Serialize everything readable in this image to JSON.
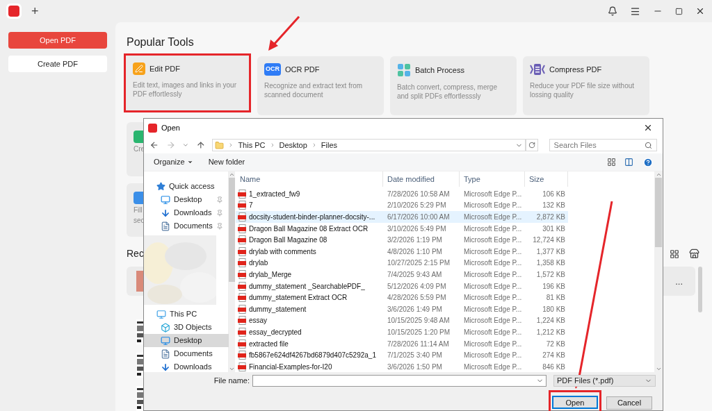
{
  "app": {
    "new_tab": "+"
  },
  "sidebar": {
    "buttons": [
      {
        "label": "Open PDF",
        "kind": "primary"
      },
      {
        "label": "Create PDF",
        "kind": "secondary"
      }
    ]
  },
  "popular_tools": {
    "title": "Popular Tools",
    "cards": [
      {
        "kind": "edit",
        "title": "Edit PDF",
        "description": "Edit text, images and links in your PDF effortlessly",
        "highlighted": true
      },
      {
        "kind": "ocr",
        "icon_text": "OCR",
        "title": "OCR PDF",
        "description": "Recognize and extract text from scanned document",
        "highlighted": false
      },
      {
        "kind": "batch",
        "title": "Batch Process",
        "description": "Batch convert, compress, merge and split PDFs effortlesssly",
        "highlighted": false
      },
      {
        "kind": "compress",
        "title": "Compress PDF",
        "description": "Reduce your PDF file size without lossing quality",
        "highlighted": false
      }
    ]
  },
  "more_tools": [
    {
      "kind": "create",
      "lines": [
        "Cre"
      ]
    },
    {
      "kind": "form",
      "lines": [
        "Fill",
        "sec"
      ]
    }
  ],
  "recent": {
    "title": "Rec",
    "more": "..."
  },
  "dialog": {
    "title": "Open",
    "breadcrumb": [
      "This PC",
      "Desktop",
      "Files"
    ],
    "search": {
      "placeholder": "Search Files"
    },
    "toolbar": [
      "Organize",
      "New folder"
    ],
    "nav": [
      {
        "label": "Quick access",
        "kind": "star",
        "selected": false,
        "children": [
          {
            "label": "Desktop",
            "kind": "desktop",
            "pinned": true,
            "selected": false
          },
          {
            "label": "Downloads",
            "kind": "download",
            "pinned": true,
            "selected": false
          },
          {
            "label": "Documents",
            "kind": "document",
            "pinned": true,
            "selected": false
          }
        ]
      },
      {
        "label": "This PC",
        "kind": "pc",
        "selected": false,
        "children": [
          {
            "label": "3D Objects",
            "kind": "objects",
            "pinned": false,
            "selected": false
          },
          {
            "label": "Desktop",
            "kind": "desktop",
            "pinned": false,
            "selected": true
          },
          {
            "label": "Documents",
            "kind": "document",
            "pinned": false,
            "selected": false
          },
          {
            "label": "Downloads",
            "kind": "download",
            "pinned": false,
            "selected": false
          }
        ]
      }
    ],
    "columns": [
      "Name",
      "Date modified",
      "Type",
      "Size"
    ],
    "rows": [
      {
        "name": "1_extracted_fw9",
        "date": "7/28/2026 10:58 AM",
        "type": "Microsoft Edge P...",
        "size": "106 KB",
        "selected": false
      },
      {
        "name": "7",
        "date": "2/10/2026 5:29 PM",
        "type": "Microsoft Edge P...",
        "size": "132 KB",
        "selected": false
      },
      {
        "name": "docsity-student-binder-planner-docsity-...",
        "date": "6/17/2026 10:00 AM",
        "type": "Microsoft Edge P...",
        "size": "2,872 KB",
        "selected": true
      },
      {
        "name": "Dragon Ball Magazine 08 Extract OCR",
        "date": "3/10/2026 5:49 PM",
        "type": "Microsoft Edge P...",
        "size": "301 KB",
        "selected": false
      },
      {
        "name": "Dragon Ball Magazine 08",
        "date": "3/2/2026 1:19 PM",
        "type": "Microsoft Edge P...",
        "size": "12,724 KB",
        "selected": false
      },
      {
        "name": "drylab with comments",
        "date": "4/8/2026 1:10 PM",
        "type": "Microsoft Edge P...",
        "size": "1,377 KB",
        "selected": false
      },
      {
        "name": "drylab",
        "date": "10/27/2025 2:15 PM",
        "type": "Microsoft Edge P...",
        "size": "1,358 KB",
        "selected": false
      },
      {
        "name": "drylab_Merge",
        "date": "7/4/2025 9:43 AM",
        "type": "Microsoft Edge P...",
        "size": "1,572 KB",
        "selected": false
      },
      {
        "name": "dummy_statement _SearchablePDF_",
        "date": "5/12/2026 4:09 PM",
        "type": "Microsoft Edge P...",
        "size": "196 KB",
        "selected": false
      },
      {
        "name": "dummy_statement Extract OCR",
        "date": "4/28/2026 5:59 PM",
        "type": "Microsoft Edge P...",
        "size": "81 KB",
        "selected": false
      },
      {
        "name": "dummy_statement",
        "date": "3/6/2026 1:49 PM",
        "type": "Microsoft Edge P...",
        "size": "180 KB",
        "selected": false
      },
      {
        "name": "essay",
        "date": "10/15/2025 9:48 AM",
        "type": "Microsoft Edge P...",
        "size": "1,224 KB",
        "selected": false
      },
      {
        "name": "essay_decrypted",
        "date": "10/15/2025 1:20 PM",
        "type": "Microsoft Edge P...",
        "size": "1,212 KB",
        "selected": false
      },
      {
        "name": "extracted file",
        "date": "7/28/2026 11:14 AM",
        "type": "Microsoft Edge P...",
        "size": "72 KB",
        "selected": false
      },
      {
        "name": "fb5867e624df4267bd6879d407c5292a_1",
        "date": "7/1/2025 3:40 PM",
        "type": "Microsoft Edge P...",
        "size": "274 KB",
        "selected": false
      },
      {
        "name": "Financial-Examples-for-I20",
        "date": "3/6/2026 1:50 PM",
        "type": "Microsoft Edge P...",
        "size": "846 KB",
        "selected": false
      }
    ],
    "file_name_label": "File name:",
    "file_type": "PDF Files (*.pdf)",
    "buttons": [
      {
        "label": "Open",
        "kind": "default",
        "highlighted": true
      },
      {
        "label": "Cancel",
        "kind": "normal",
        "highlighted": false
      }
    ]
  }
}
